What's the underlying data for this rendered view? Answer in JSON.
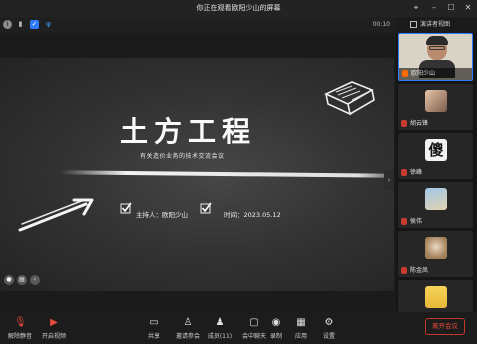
{
  "window": {
    "title": "你正在观看欧阳少山的屏幕"
  },
  "infobar": {
    "timer": "00:10",
    "view_button": "演讲者视图"
  },
  "slide": {
    "title": "土方工程",
    "subtitle": "有关造价业务的技术交流会议",
    "host": "主持人：欧阳少山",
    "date": "时间：2023.05.12"
  },
  "participants": [
    {
      "name": "欧阳少山",
      "active": true
    },
    {
      "name": "胡云锋"
    },
    {
      "name": "徐峰"
    },
    {
      "name": "侯伟"
    },
    {
      "name": "陈金凤"
    },
    {
      "name": ""
    }
  ],
  "toolbar": {
    "mute_label": "解除静音",
    "video_label": "开启视频",
    "share_label": "共享",
    "invite_label": "邀请参会",
    "members_label": "成员(11)",
    "chat_label": "会中聊天",
    "record_label": "录制",
    "apps_label": "应用",
    "settings_label": "设置",
    "leave_label": "离开会议"
  },
  "colors": {
    "accent": "#2e7bff",
    "danger": "#c0392b",
    "background": "#1b1b1b"
  }
}
